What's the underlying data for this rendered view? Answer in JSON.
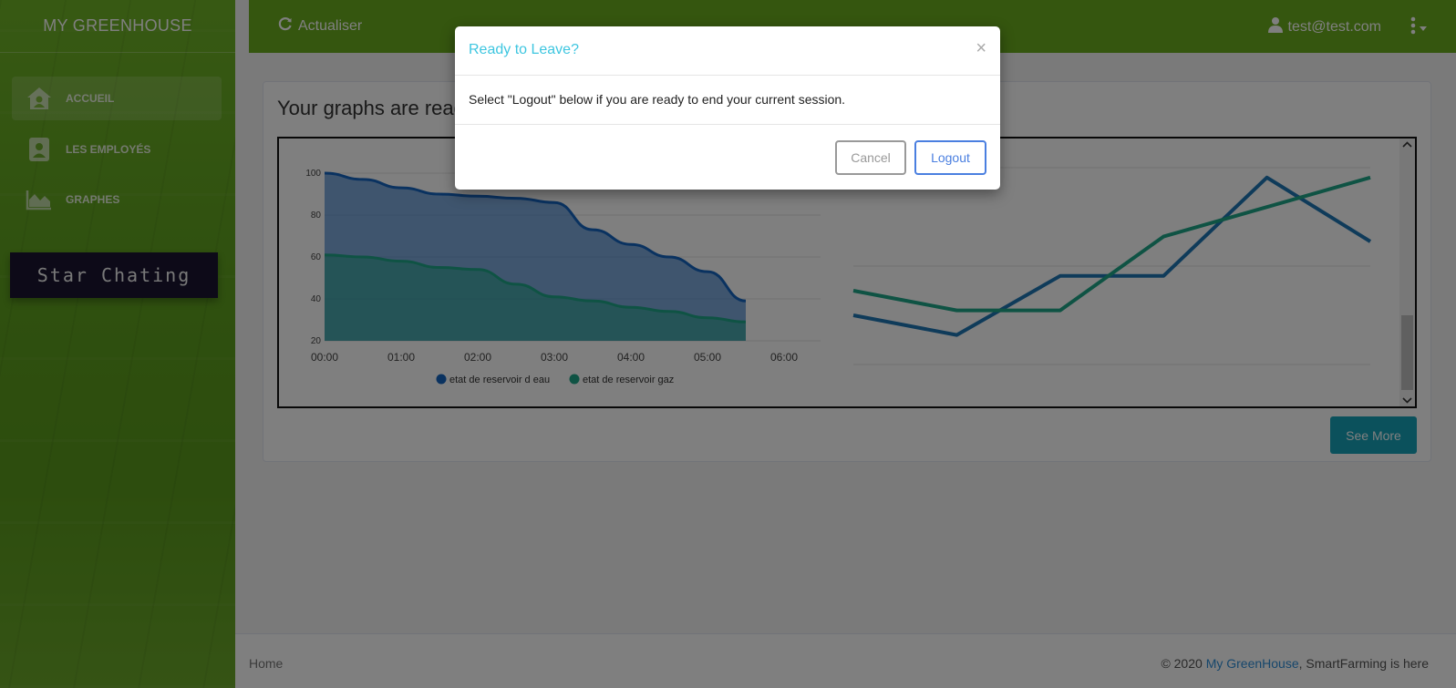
{
  "brand": "MY GREENHOUSE",
  "sidebar": {
    "items": [
      {
        "label": "ACCUEIL",
        "icon": "home-icon"
      },
      {
        "label": "LES EMPLOYÉS",
        "icon": "id-card-icon"
      },
      {
        "label": "GRAPHES",
        "icon": "area-chart-icon"
      }
    ],
    "chat_button": "Star Chating"
  },
  "topbar": {
    "refresh_label": "Actualiser",
    "user_email": "test@test.com"
  },
  "card": {
    "title": "Your graphs are read",
    "see_more": "See More"
  },
  "footer": {
    "left": "Home",
    "copyright": "© 2020 ",
    "link": "My GreenHouse",
    "tagline": ", SmartFarming is here"
  },
  "modal": {
    "title": "Ready to Leave?",
    "close": "×",
    "body": "Select \"Logout\" below if you are ready to end your current session.",
    "cancel": "Cancel",
    "logout": "Logout"
  },
  "colors": {
    "series_water": "#1565c0",
    "series_gas": "#1fa688",
    "accent": "#3ec6e0"
  },
  "chart_data": [
    {
      "type": "area",
      "x": [
        "00:00",
        "00:30",
        "01:00",
        "01:30",
        "02:00",
        "02:30",
        "03:00",
        "03:30",
        "04:00",
        "04:30",
        "05:00",
        "05:30"
      ],
      "xticks": [
        "00:00",
        "01:00",
        "02:00",
        "03:00",
        "04:00",
        "05:00",
        "06:00"
      ],
      "yticks": [
        100,
        80,
        60,
        40,
        20
      ],
      "ylim": [
        20,
        100
      ],
      "series": [
        {
          "name": "etat de reservoir d eau",
          "values": [
            100,
            97,
            93,
            90,
            89,
            88,
            86,
            73,
            66,
            60,
            53,
            39
          ]
        },
        {
          "name": "etat de reservoir gaz",
          "values": [
            61,
            60,
            58,
            55,
            54,
            47,
            41,
            39,
            36,
            34,
            31,
            29
          ]
        }
      ],
      "legend": "bottom"
    },
    {
      "type": "line",
      "x": [
        0,
        1,
        2,
        3,
        4,
        5
      ],
      "series": [
        {
          "values": [
            50,
            46,
            58,
            58,
            78,
            65
          ]
        },
        {
          "values": [
            55,
            51,
            51,
            66,
            72,
            78
          ]
        }
      ],
      "ylim": [
        40,
        80
      ]
    }
  ]
}
